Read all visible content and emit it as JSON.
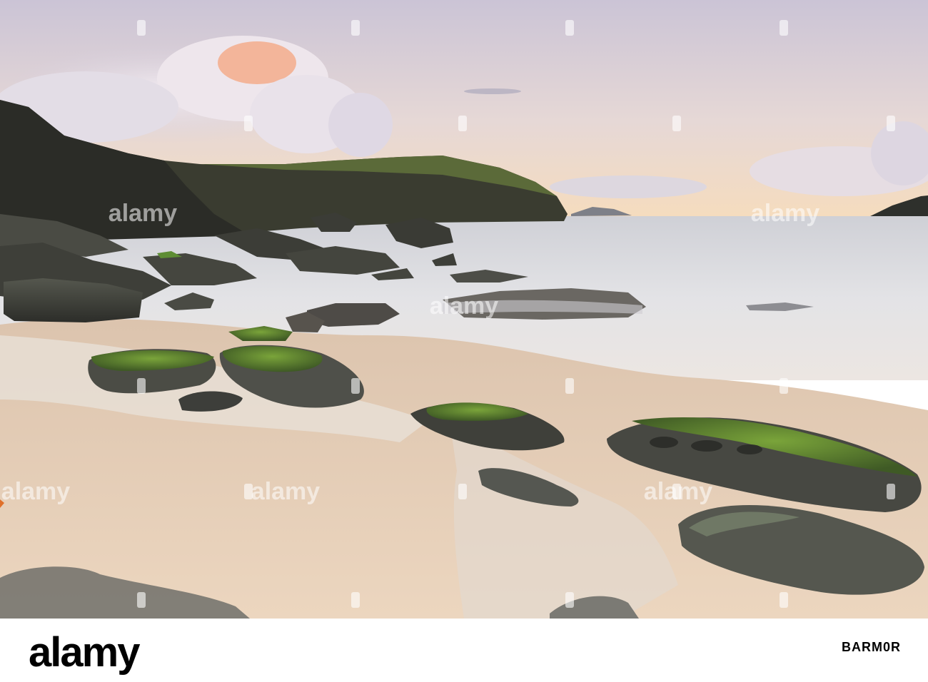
{
  "image": {
    "description_alt": "Rocky sandy beach at dusk with cliffs and a long-exposure misty sea"
  },
  "watermark": {
    "text": "alamy"
  },
  "footer": {
    "brand": "alamy",
    "stock_id": "BARM0R"
  },
  "colors": {
    "sky_top": "#cfc8d8",
    "sky_horizon": "#f4dcc0",
    "sea": "#dcdde2",
    "sand": "#e4cdb4",
    "rock": "#3e3f3a",
    "moss": "#5f8a2e",
    "cliff": "#2f3128"
  }
}
